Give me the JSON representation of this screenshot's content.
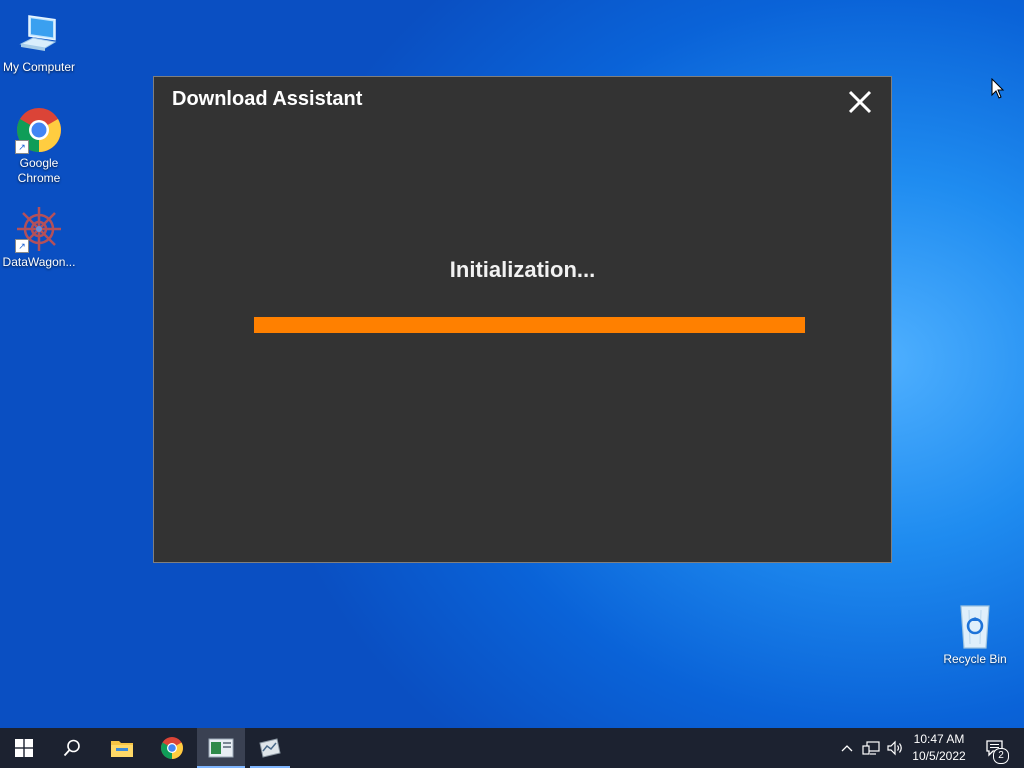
{
  "desktop": {
    "icons": [
      {
        "label": "My Computer"
      },
      {
        "label": "Google Chrome"
      },
      {
        "label": "DataWagon..."
      },
      {
        "label": "Recycle Bin"
      }
    ]
  },
  "dialog": {
    "title": "Download Assistant",
    "status": "Initialization...",
    "progress_fraction": 1.0,
    "progress_color": "#ff8000",
    "background": "#333333"
  },
  "taskbar": {
    "buttons": [
      {
        "icon": "windows-start-icon"
      },
      {
        "icon": "search-icon"
      },
      {
        "icon": "file-explorer-icon"
      },
      {
        "icon": "chrome-icon"
      },
      {
        "icon": "download-assistant-app-icon"
      },
      {
        "icon": "datawagon-app-icon"
      }
    ],
    "clock": {
      "time": "10:47 AM",
      "date": "10/5/2022"
    },
    "notification_count": "2"
  }
}
